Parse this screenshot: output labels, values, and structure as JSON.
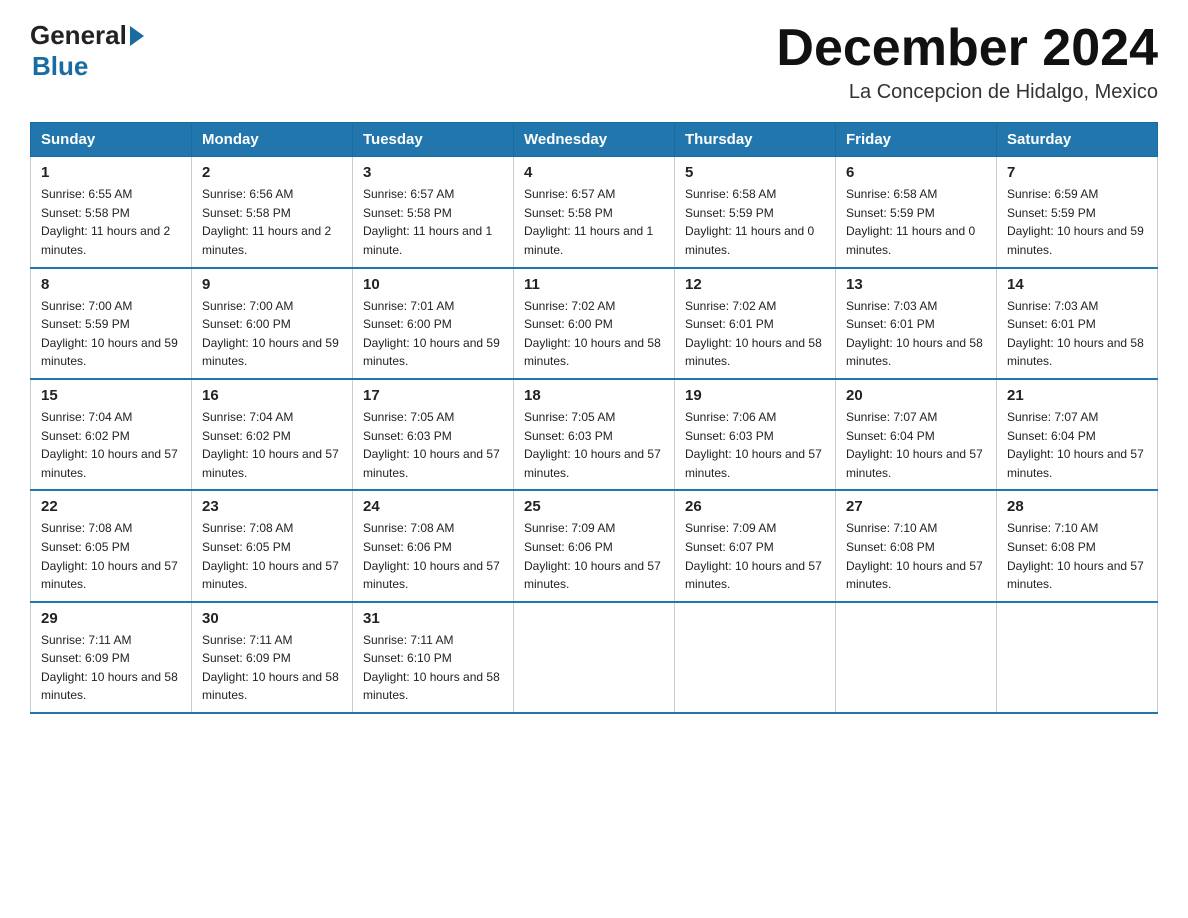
{
  "header": {
    "logo_general": "General",
    "logo_blue": "Blue",
    "title": "December 2024",
    "location": "La Concepcion de Hidalgo, Mexico"
  },
  "days_of_week": [
    "Sunday",
    "Monday",
    "Tuesday",
    "Wednesday",
    "Thursday",
    "Friday",
    "Saturday"
  ],
  "weeks": [
    [
      {
        "day": "1",
        "sunrise": "6:55 AM",
        "sunset": "5:58 PM",
        "daylight": "11 hours and 2 minutes."
      },
      {
        "day": "2",
        "sunrise": "6:56 AM",
        "sunset": "5:58 PM",
        "daylight": "11 hours and 2 minutes."
      },
      {
        "day": "3",
        "sunrise": "6:57 AM",
        "sunset": "5:58 PM",
        "daylight": "11 hours and 1 minute."
      },
      {
        "day": "4",
        "sunrise": "6:57 AM",
        "sunset": "5:58 PM",
        "daylight": "11 hours and 1 minute."
      },
      {
        "day": "5",
        "sunrise": "6:58 AM",
        "sunset": "5:59 PM",
        "daylight": "11 hours and 0 minutes."
      },
      {
        "day": "6",
        "sunrise": "6:58 AM",
        "sunset": "5:59 PM",
        "daylight": "11 hours and 0 minutes."
      },
      {
        "day": "7",
        "sunrise": "6:59 AM",
        "sunset": "5:59 PM",
        "daylight": "10 hours and 59 minutes."
      }
    ],
    [
      {
        "day": "8",
        "sunrise": "7:00 AM",
        "sunset": "5:59 PM",
        "daylight": "10 hours and 59 minutes."
      },
      {
        "day": "9",
        "sunrise": "7:00 AM",
        "sunset": "6:00 PM",
        "daylight": "10 hours and 59 minutes."
      },
      {
        "day": "10",
        "sunrise": "7:01 AM",
        "sunset": "6:00 PM",
        "daylight": "10 hours and 59 minutes."
      },
      {
        "day": "11",
        "sunrise": "7:02 AM",
        "sunset": "6:00 PM",
        "daylight": "10 hours and 58 minutes."
      },
      {
        "day": "12",
        "sunrise": "7:02 AM",
        "sunset": "6:01 PM",
        "daylight": "10 hours and 58 minutes."
      },
      {
        "day": "13",
        "sunrise": "7:03 AM",
        "sunset": "6:01 PM",
        "daylight": "10 hours and 58 minutes."
      },
      {
        "day": "14",
        "sunrise": "7:03 AM",
        "sunset": "6:01 PM",
        "daylight": "10 hours and 58 minutes."
      }
    ],
    [
      {
        "day": "15",
        "sunrise": "7:04 AM",
        "sunset": "6:02 PM",
        "daylight": "10 hours and 57 minutes."
      },
      {
        "day": "16",
        "sunrise": "7:04 AM",
        "sunset": "6:02 PM",
        "daylight": "10 hours and 57 minutes."
      },
      {
        "day": "17",
        "sunrise": "7:05 AM",
        "sunset": "6:03 PM",
        "daylight": "10 hours and 57 minutes."
      },
      {
        "day": "18",
        "sunrise": "7:05 AM",
        "sunset": "6:03 PM",
        "daylight": "10 hours and 57 minutes."
      },
      {
        "day": "19",
        "sunrise": "7:06 AM",
        "sunset": "6:03 PM",
        "daylight": "10 hours and 57 minutes."
      },
      {
        "day": "20",
        "sunrise": "7:07 AM",
        "sunset": "6:04 PM",
        "daylight": "10 hours and 57 minutes."
      },
      {
        "day": "21",
        "sunrise": "7:07 AM",
        "sunset": "6:04 PM",
        "daylight": "10 hours and 57 minutes."
      }
    ],
    [
      {
        "day": "22",
        "sunrise": "7:08 AM",
        "sunset": "6:05 PM",
        "daylight": "10 hours and 57 minutes."
      },
      {
        "day": "23",
        "sunrise": "7:08 AM",
        "sunset": "6:05 PM",
        "daylight": "10 hours and 57 minutes."
      },
      {
        "day": "24",
        "sunrise": "7:08 AM",
        "sunset": "6:06 PM",
        "daylight": "10 hours and 57 minutes."
      },
      {
        "day": "25",
        "sunrise": "7:09 AM",
        "sunset": "6:06 PM",
        "daylight": "10 hours and 57 minutes."
      },
      {
        "day": "26",
        "sunrise": "7:09 AM",
        "sunset": "6:07 PM",
        "daylight": "10 hours and 57 minutes."
      },
      {
        "day": "27",
        "sunrise": "7:10 AM",
        "sunset": "6:08 PM",
        "daylight": "10 hours and 57 minutes."
      },
      {
        "day": "28",
        "sunrise": "7:10 AM",
        "sunset": "6:08 PM",
        "daylight": "10 hours and 57 minutes."
      }
    ],
    [
      {
        "day": "29",
        "sunrise": "7:11 AM",
        "sunset": "6:09 PM",
        "daylight": "10 hours and 58 minutes."
      },
      {
        "day": "30",
        "sunrise": "7:11 AM",
        "sunset": "6:09 PM",
        "daylight": "10 hours and 58 minutes."
      },
      {
        "day": "31",
        "sunrise": "7:11 AM",
        "sunset": "6:10 PM",
        "daylight": "10 hours and 58 minutes."
      },
      null,
      null,
      null,
      null
    ]
  ]
}
